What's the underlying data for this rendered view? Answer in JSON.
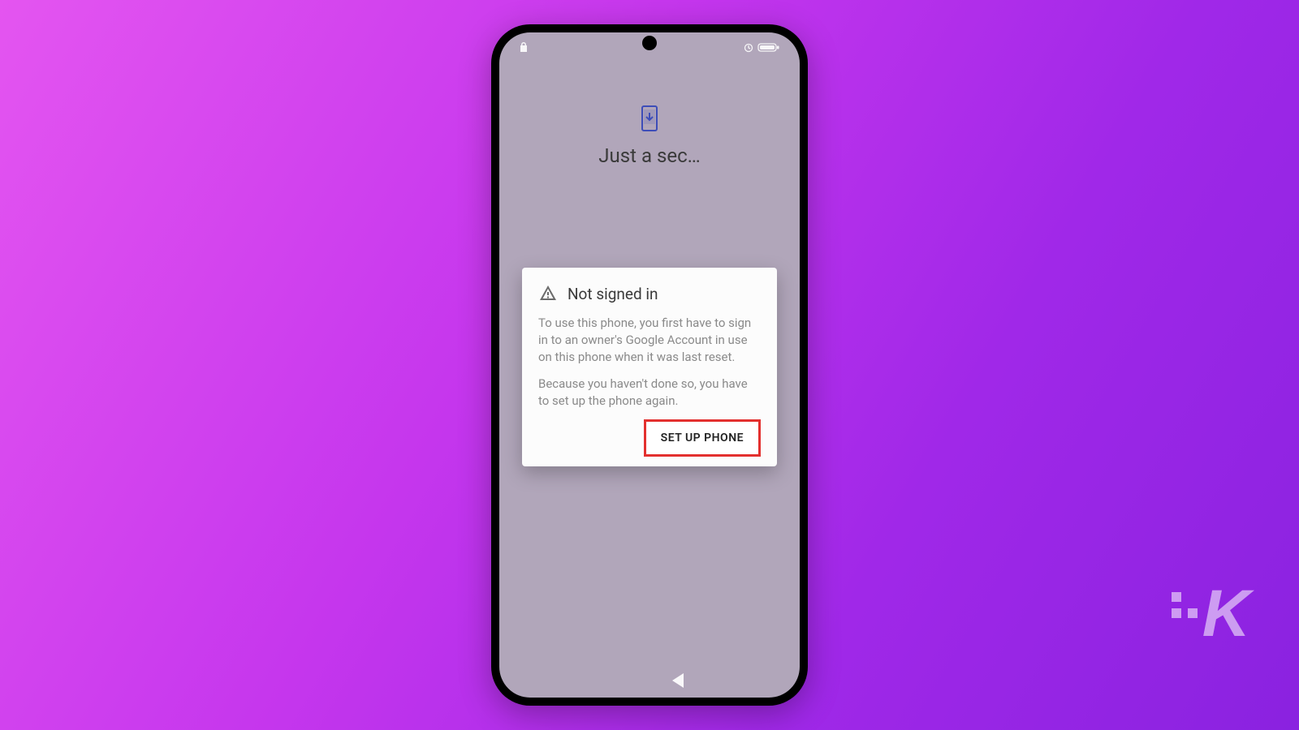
{
  "header": {
    "title": "Just a sec…"
  },
  "dialog": {
    "title": "Not signed in",
    "body1": "To use this phone, you first have to sign in to an owner's Google Account in use on this phone when it was last reset.",
    "body2": "Because you haven't done so, you have to set up the phone again.",
    "action_label": "SET UP PHONE"
  },
  "watermark": {
    "letter": "K"
  }
}
